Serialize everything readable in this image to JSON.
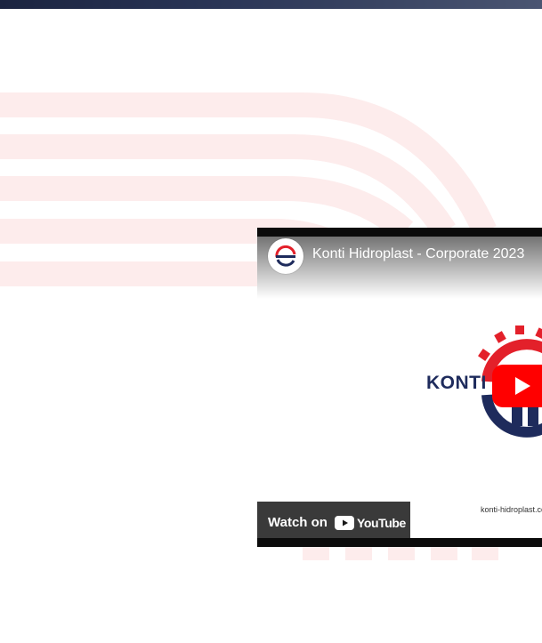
{
  "video": {
    "title": "Konti Hidroplast - Corporate 2023",
    "watch_on_label": "Watch on",
    "youtube_wordmark": "YouTube",
    "logo_text": "KONTI",
    "site_url": "konti-hidroplast.com"
  },
  "colors": {
    "accent_red": "#ff0000",
    "brand_navy": "#1e2b5c",
    "arc_tint": "#fdecec"
  },
  "icons": {
    "channel_avatar": "konti-logo-icon",
    "play": "play-icon",
    "youtube": "youtube-icon"
  }
}
